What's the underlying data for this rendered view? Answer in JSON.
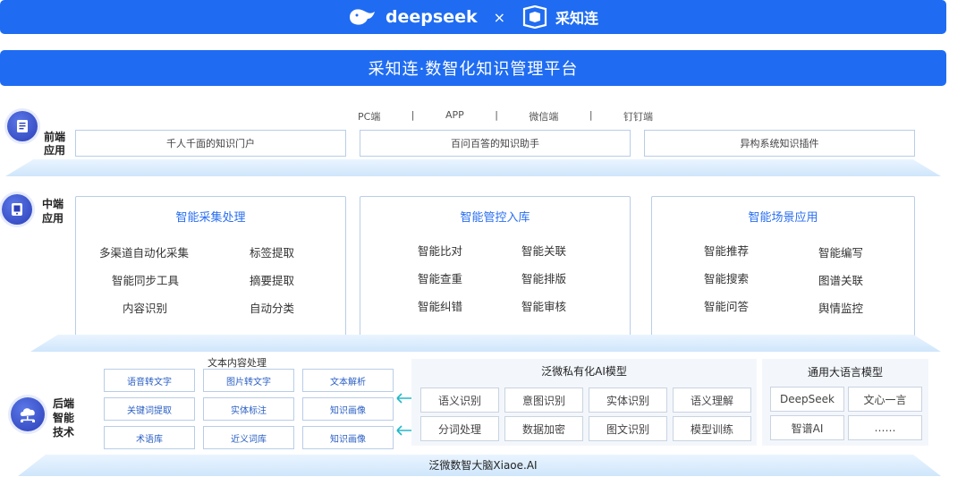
{
  "header": {
    "brand_left": "deepseek",
    "times": "×",
    "brand_right": "采知连",
    "title": "采知连·数智化知识管理平台"
  },
  "frontend": {
    "tier_label_1": "前端",
    "tier_label_2": "应用",
    "channels": [
      "PC端",
      "|",
      "APP",
      "|",
      "微信端",
      "|",
      "钉钉端"
    ],
    "boxes": [
      "千人千面的知识门户",
      "百问百答的知识助手",
      "异构系统知识插件"
    ]
  },
  "middle": {
    "tier_label_1": "中端",
    "tier_label_2": "应用",
    "cards": [
      {
        "title": "智能采集处理",
        "left": [
          "多渠道自动化采集",
          "智能同步工具",
          "内容识别"
        ],
        "right": [
          "标签提取",
          "摘要提取",
          "自动分类"
        ]
      },
      {
        "title": "智能管控入库",
        "left": [
          "智能比对",
          "智能查重",
          "智能纠错"
        ],
        "right": [
          "智能关联",
          "智能排版",
          "智能审核"
        ]
      },
      {
        "title": "智能场景应用",
        "left": [
          "智能推荐",
          "智能搜索",
          "智能问答"
        ],
        "right": [
          "智能编写",
          "图谱关联",
          "舆情监控"
        ]
      }
    ]
  },
  "backend": {
    "tier_label_1": "后端",
    "tier_label_2": "智能",
    "tier_label_3": "技术",
    "text_processing_title": "文本内容处理",
    "text_processing": [
      [
        "语音转文字",
        "图片转文字",
        "文本解析"
      ],
      [
        "关键词提取",
        "实体标注",
        "知识画像"
      ],
      [
        "术语库",
        "近义词库",
        "知识画像"
      ]
    ],
    "private_model_title": "泛微私有化AI模型",
    "private_model": [
      [
        "语义识别",
        "意图识别",
        "实体识别",
        "语义理解"
      ],
      [
        "分词处理",
        "数据加密",
        "图文识别",
        "模型训练"
      ]
    ],
    "llm_title": "通用大语言模型",
    "llm": [
      [
        "DeepSeek",
        "文心一言"
      ],
      [
        "智谱AI",
        "……"
      ]
    ],
    "footer": "泛微数智大脑Xiaoe.AI"
  },
  "colors": {
    "primary": "#1f6cf2",
    "accent_text": "#2a6ff0",
    "border": "#b9cde8",
    "icon": "#2c3fb8"
  }
}
